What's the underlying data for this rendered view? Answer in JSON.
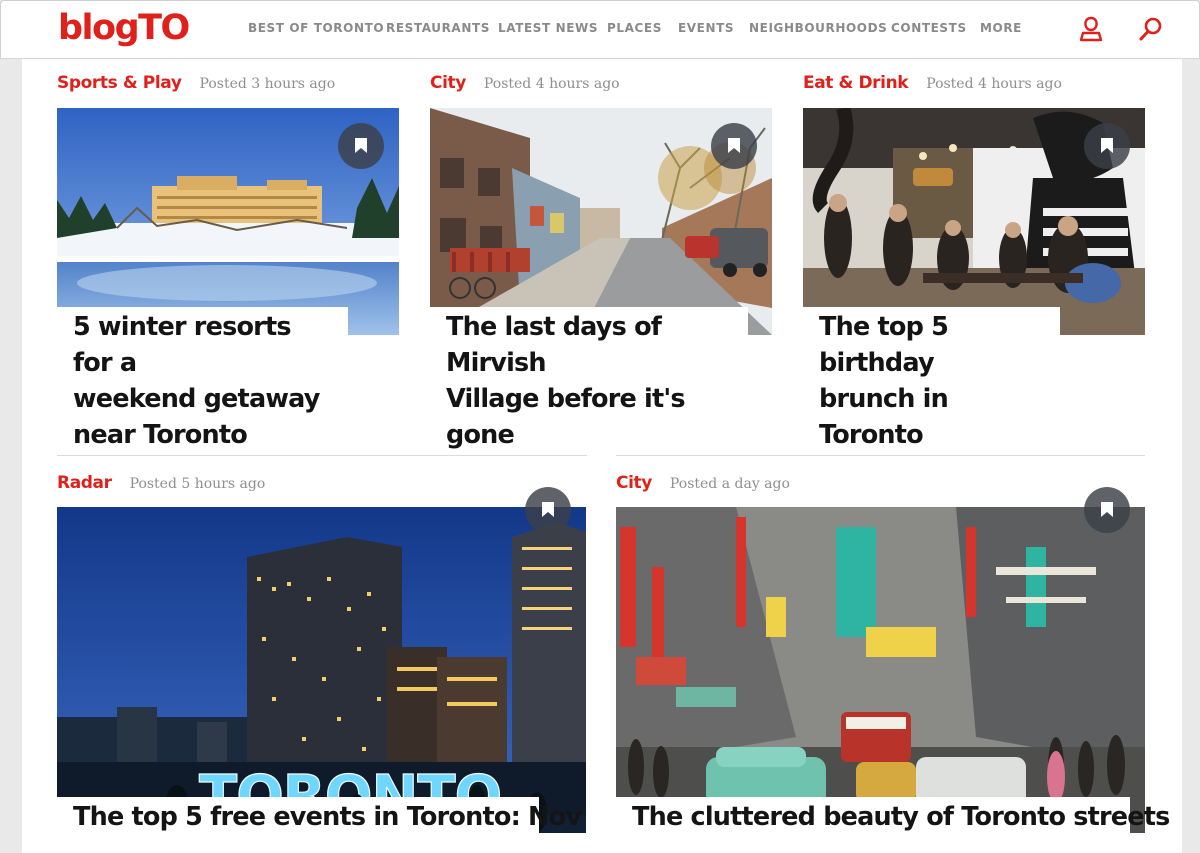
{
  "header": {
    "logo": "blogTO",
    "nav": [
      {
        "label": "BEST OF TORONTO"
      },
      {
        "label": "RESTAURANTS"
      },
      {
        "label": "LATEST NEWS"
      },
      {
        "label": "PLACES"
      },
      {
        "label": "EVENTS"
      },
      {
        "label": "NEIGHBOURHOODS"
      },
      {
        "label": "CONTESTS"
      },
      {
        "label": "MORE"
      }
    ],
    "icons": {
      "account": "user-icon",
      "search": "search-icon"
    }
  },
  "articles": [
    {
      "category": "Sports & Play",
      "posted": "Posted 3 hours ago",
      "title": [
        "5 winter resorts for a",
        "weekend getaway",
        "near Toronto"
      ]
    },
    {
      "category": "City",
      "posted": "Posted 4 hours ago",
      "title": [
        "The last days of Mirvish",
        "Village before it's gone"
      ]
    },
    {
      "category": "Eat & Drink",
      "posted": "Posted 4 hours ago",
      "title": [
        "The top 5 birthday",
        "brunch in Toronto"
      ]
    },
    {
      "category": "Radar",
      "posted": "Posted 5 hours ago",
      "title": [
        "The top 5 free events in Toronto: Nov"
      ]
    },
    {
      "category": "City",
      "posted": "Posted a day ago",
      "title": [
        "The cluttered beauty of Toronto streets"
      ]
    }
  ],
  "images": {
    "toronto_sign": "TORONTO"
  },
  "colors": {
    "brand": "#e0211b",
    "muted": "#8a8a8a",
    "bookmark_bg": "#3c4048"
  }
}
